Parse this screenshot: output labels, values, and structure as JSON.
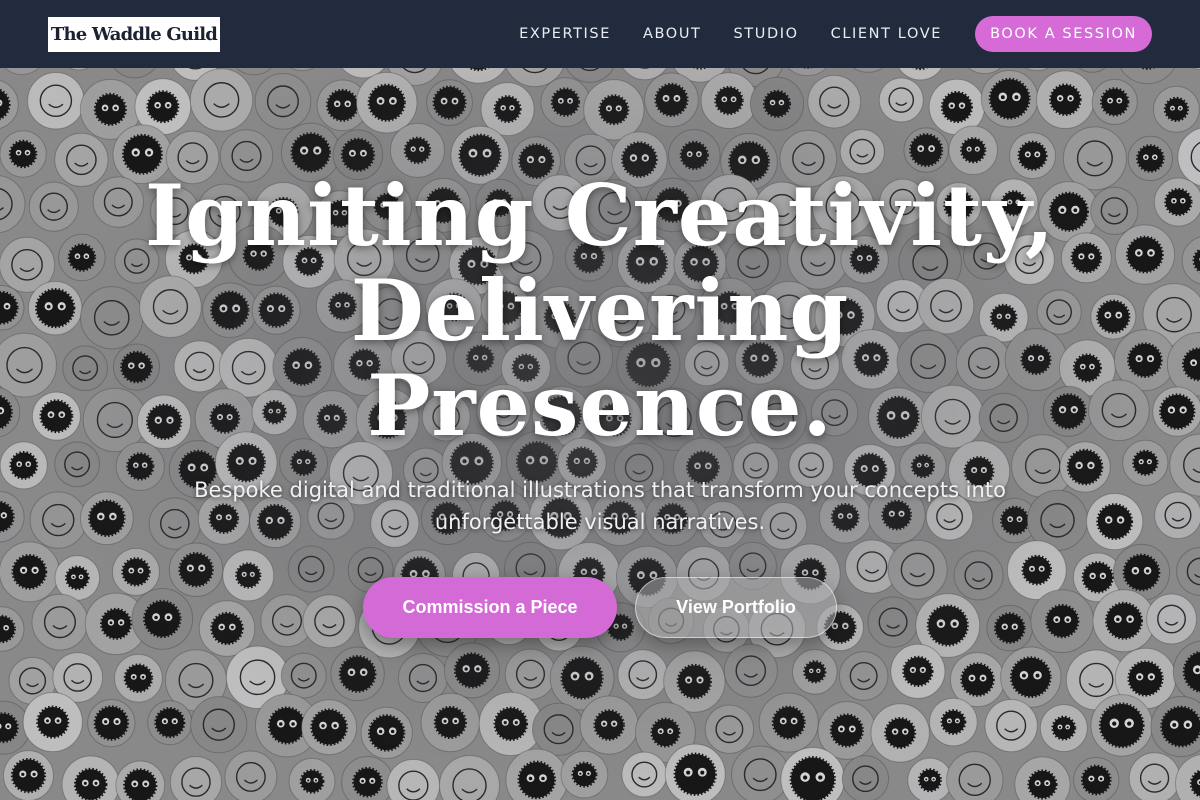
{
  "brand": {
    "name": "The Waddle Guild"
  },
  "nav": {
    "links": [
      "EXPERTISE",
      "ABOUT",
      "STUDIO",
      "CLIENT LOVE"
    ],
    "cta_label": "BOOK A SESSION"
  },
  "hero": {
    "headline_lines": [
      "Igniting Creativity,",
      "Delivering",
      "Presence."
    ],
    "subtext": "Bespoke digital and traditional illustrations that transform your concepts into unforgettable visual narratives.",
    "primary_button": "Commission a Piece",
    "secondary_button": "View Portfolio"
  },
  "colors": {
    "nav_background": "#222b3d",
    "accent": "#d66bd8",
    "logo_background": "#ffffff",
    "logo_text": "#1d2233"
  },
  "background_image": {
    "description_icon": "doodle-sticker-collage"
  }
}
